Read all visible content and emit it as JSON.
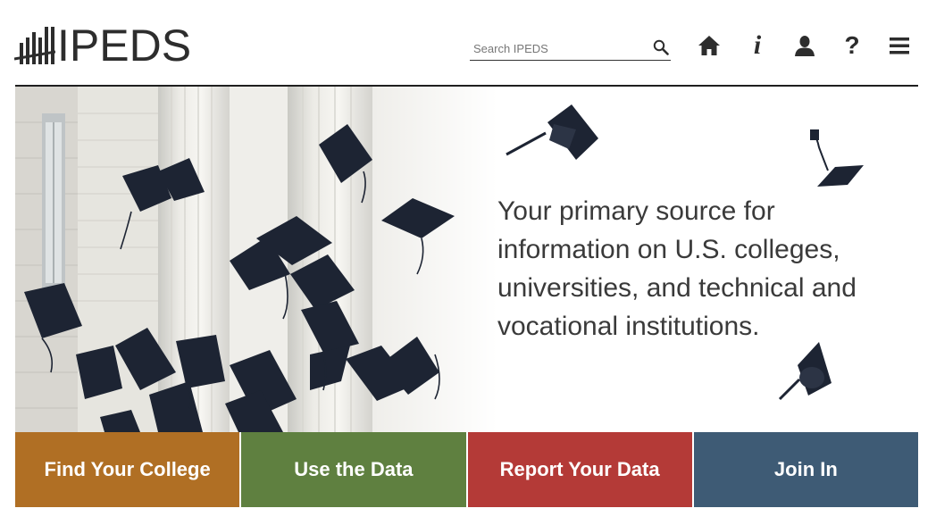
{
  "header": {
    "logo_text": "IPEDS",
    "search": {
      "placeholder": "Search IPEDS"
    },
    "nav_icons": [
      "search-icon",
      "home-icon",
      "info-icon",
      "user-icon",
      "help-icon",
      "menu-icon"
    ],
    "info_glyph": "i",
    "help_glyph": "?"
  },
  "hero": {
    "tagline": "Your primary source for information on U.S. colleges, universities, and technical and vocational institutions.",
    "image": "graduation caps thrown in the air in front of columns"
  },
  "tiles": [
    {
      "label": "Find Your College",
      "color": "#b06f24"
    },
    {
      "label": "Use the Data",
      "color": "#5f8040"
    },
    {
      "label": "Report Your Data",
      "color": "#b43a37"
    },
    {
      "label": "Join In",
      "color": "#3e5b75"
    }
  ],
  "colors": {
    "text_dark": "#2d2d2d",
    "cap": "#1d2433"
  }
}
